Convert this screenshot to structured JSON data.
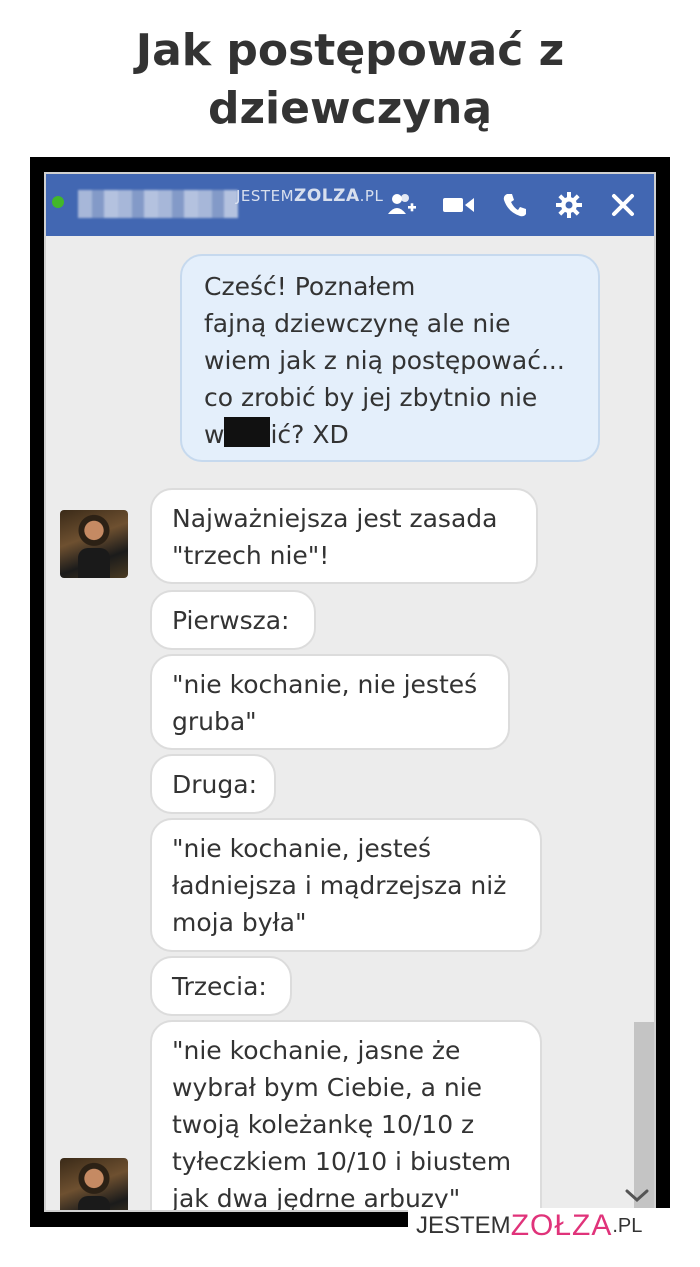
{
  "meme": {
    "title_line1": "Jak postępować z",
    "title_line2": "dziewczyną"
  },
  "chat_header": {
    "watermark_prefix": "JESTEM",
    "watermark_brand": "ZOLZA",
    "watermark_suffix": ".PL",
    "icons": [
      "add-person-icon",
      "video-call-icon",
      "phone-icon",
      "gear-icon",
      "close-icon"
    ],
    "accent_color": "#4267b2"
  },
  "messages": {
    "sent_1": {
      "lines": [
        "Cześć! Poznałem",
        "fajną dziewczynę ale nie",
        "wiem jak z nią postępować...",
        "co zrobić by jej zbytnio nie"
      ],
      "last_prefix": "w",
      "last_suffix": "ić? XD"
    },
    "recv_1": [
      "Najważniejsza jest zasada",
      "\"trzech nie\"!"
    ],
    "recv_2": "Pierwsza:",
    "recv_3": [
      "\"nie kochanie, nie jesteś",
      "gruba\""
    ],
    "recv_4": "Druga:",
    "recv_5": [
      "\"nie kochanie, jesteś",
      "ładniejsza i mądrzejsza niż",
      "moja była\""
    ],
    "recv_6": "Trzecia:",
    "recv_7": [
      "\"nie kochanie, jasne że",
      "wybrał bym Ciebie, a nie",
      "twoją koleżankę 10/10 z",
      "tyłeczkiem 10/10 i biustem",
      "jak dwa jędrne arbuzy\""
    ]
  },
  "footer": {
    "prefix": "JESTEM",
    "brand": "ZOŁZA",
    "suffix": ".PL"
  }
}
